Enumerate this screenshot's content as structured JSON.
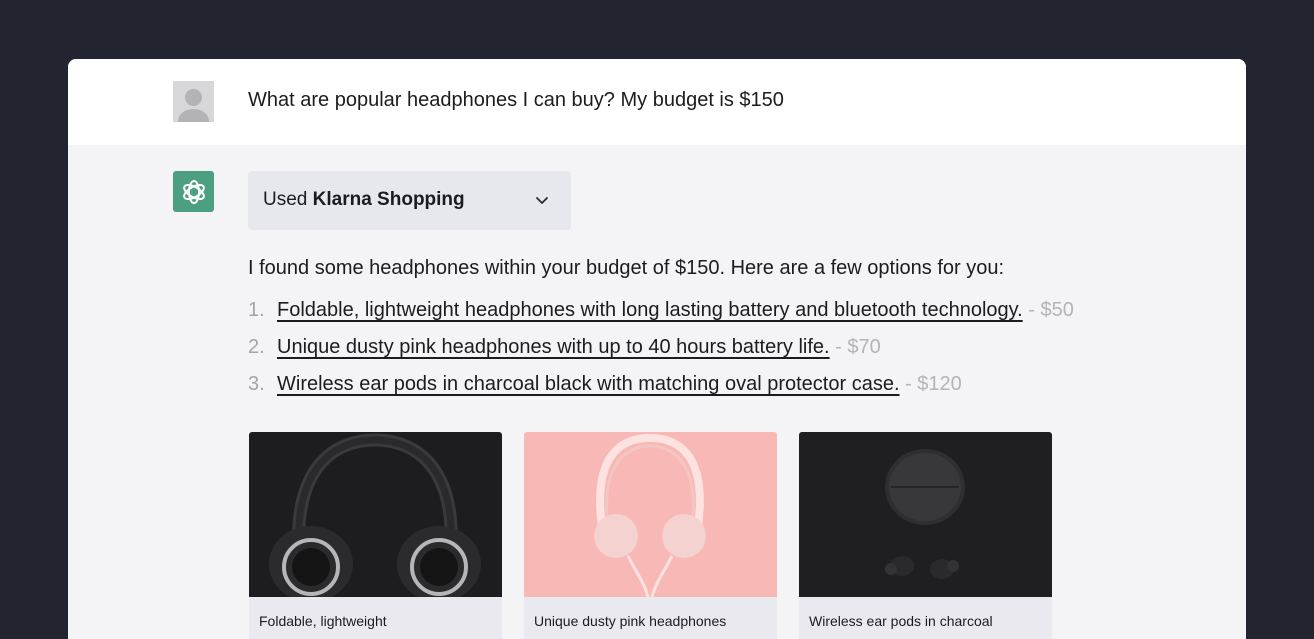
{
  "user": {
    "avatar_icon": "user-silhouette-icon",
    "message": "What are popular headphones I can buy? My budget is $150"
  },
  "assistant": {
    "avatar_icon": "chatgpt-logo-icon",
    "plugin": {
      "prefix": "Used ",
      "name": "Klarna Shopping",
      "toggle_icon": "chevron-down-icon"
    },
    "intro": "I found some headphones within your budget of $150. Here are a few options for you:",
    "options": [
      {
        "num": "1.",
        "title": "Foldable, lightweight headphones with long lasting battery and bluetooth technology.",
        "sep": " - ",
        "price": "$50"
      },
      {
        "num": "2.",
        "title": "Unique dusty pink headphones with up to 40 hours battery life.",
        "sep": " - ",
        "price": "$70"
      },
      {
        "num": "3.",
        "title": "Wireless ear pods in charcoal black with matching oval protector case.",
        "sep": " - ",
        "price": "$120"
      }
    ],
    "cards": [
      {
        "caption": "Foldable, lightweight",
        "image": "black-over-ear-headphones-photo",
        "color": "#1d1d1f"
      },
      {
        "caption": "Unique dusty pink headphones",
        "image": "pink-headphones-photo",
        "color": "#f7b8b6"
      },
      {
        "caption": "Wireless ear pods in charcoal",
        "image": "charcoal-earpods-photo",
        "color": "#1f1f22"
      }
    ]
  },
  "colors": {
    "background": "#22252f",
    "user_row": "#ffffff",
    "assistant_row": "#f4f4f6",
    "brand_green": "#4c9f80"
  }
}
